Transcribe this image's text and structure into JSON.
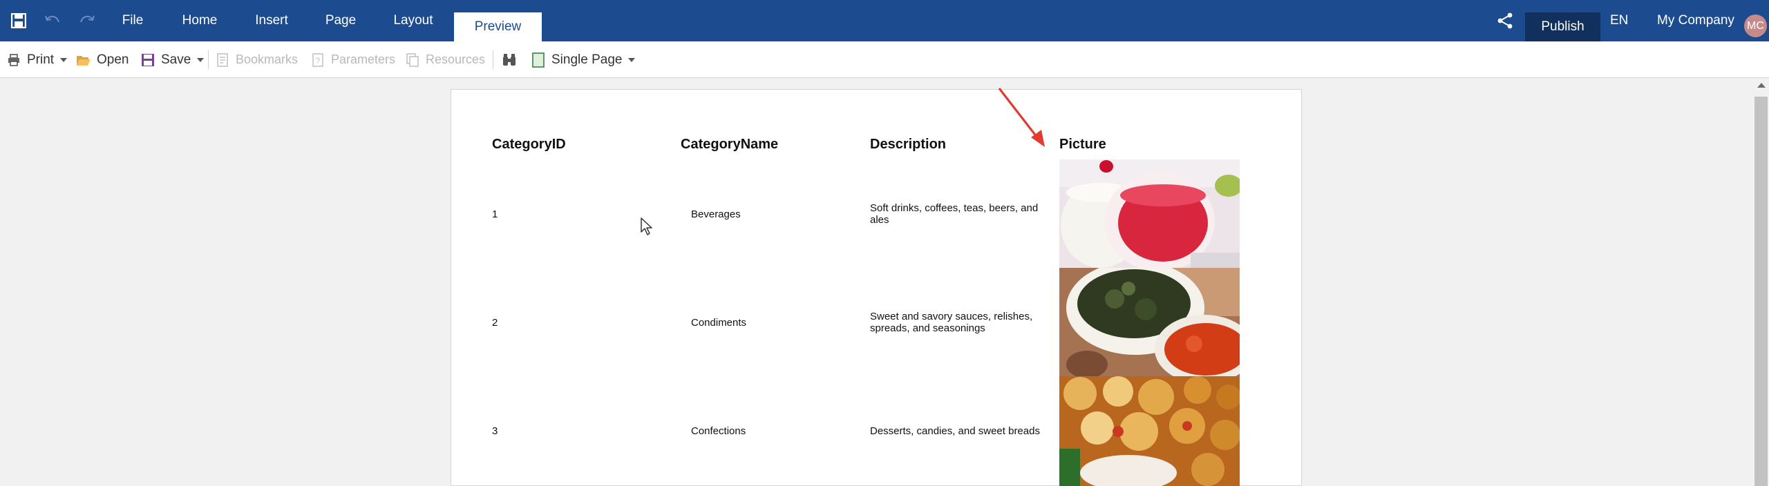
{
  "topbar": {
    "menus": [
      "File",
      "Home",
      "Insert",
      "Page",
      "Layout",
      "Preview"
    ],
    "active_menu": "Preview",
    "publish_label": "Publish",
    "language": "EN",
    "company": "My Company",
    "avatar_initials": "MC",
    "colors": {
      "ribbon": "#1d4b8f",
      "publish": "#12305e"
    }
  },
  "toolbar": {
    "print": "Print",
    "open": "Open",
    "save": "Save",
    "bookmarks": "Bookmarks",
    "parameters": "Parameters",
    "resources": "Resources",
    "view_mode": "Single Page"
  },
  "report": {
    "columns": [
      "CategoryID",
      "CategoryName",
      "Description",
      "Picture"
    ],
    "rows": [
      {
        "id": "1",
        "name": "Beverages",
        "desc": "Soft drinks, coffees, teas, beers, and ales",
        "picture": "beverages-photo"
      },
      {
        "id": "2",
        "name": "Condiments",
        "desc": "Sweet and savory sauces, relishes, spreads, and seasonings",
        "picture": "condiments-photo"
      },
      {
        "id": "3",
        "name": "Confections",
        "desc": "Desserts, candies, and sweet breads",
        "picture": "confections-photo"
      }
    ]
  },
  "annotation": {
    "arrow_color": "#e03c31"
  }
}
